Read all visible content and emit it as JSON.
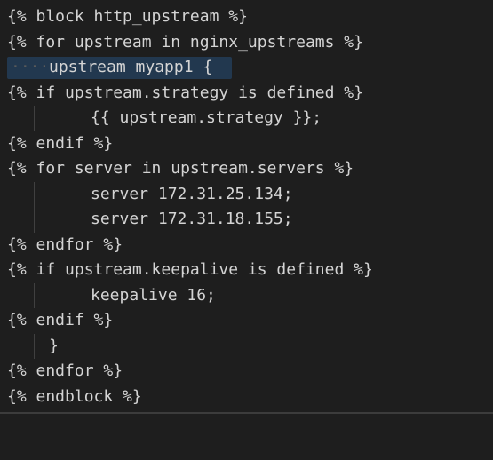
{
  "editor": {
    "lines": [
      "{% block http_upstream %}",
      "{% for upstream in nginx_upstreams %}",
      "upstream myapp1 {",
      "{% if upstream.strategy is defined %}",
      "{{ upstream.strategy }};",
      "{% endif %}",
      "{% for server in upstream.servers %}",
      "server 172.31.25.134;",
      "server 172.31.18.155;",
      "{% endfor %}",
      "{% if upstream.keepalive is defined %}",
      "keepalive 16;",
      "{% endif %}",
      "}",
      "{% endfor %}",
      "{% endblock %}"
    ],
    "whitespace_dots": "····",
    "colors": {
      "background": "#1e1e1e",
      "text": "#d4d4d4",
      "selection": "#264f78",
      "indent_guide": "#404040"
    }
  }
}
